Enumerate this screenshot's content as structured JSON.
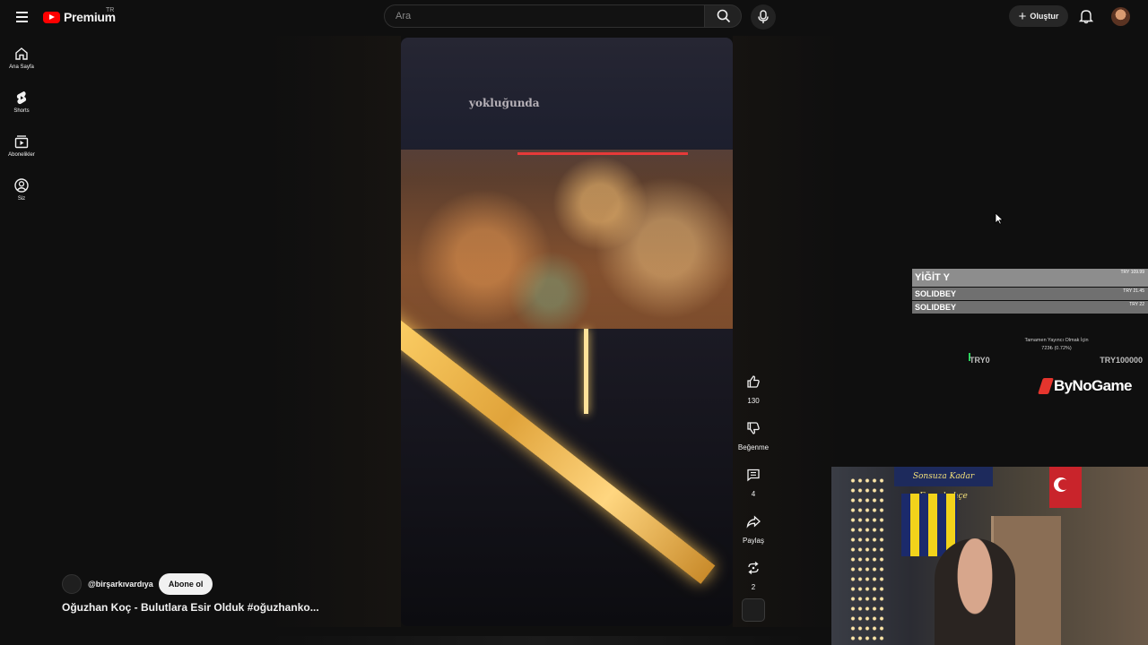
{
  "header": {
    "logo_text": "Premium",
    "country_code": "TR",
    "search_placeholder": "Ara",
    "create_label": "Oluştur"
  },
  "sidebar": {
    "items": [
      {
        "label": "Ana Sayfa",
        "icon": "home-icon"
      },
      {
        "label": "Shorts",
        "icon": "shorts-icon"
      },
      {
        "label": "Abonelikler",
        "icon": "subscriptions-icon"
      },
      {
        "label": "Siz",
        "icon": "account-circle-icon"
      }
    ]
  },
  "short": {
    "caption_overlay": "yokluğunda",
    "channel_name": "@birşarkıvardıya",
    "subscribe_label": "Abone ol",
    "title": "Oğuzhan Koç - Bulutlara Esir Olduk #oğuzhanko..."
  },
  "actions": {
    "like_count": "130",
    "dislike_label": "Beğenme",
    "comment_count": "4",
    "share_label": "Paylaş",
    "remix_count": "2"
  },
  "overlay": {
    "donations": [
      {
        "name": "YİĞİT Y",
        "amount": "TRY 109.99"
      },
      {
        "name": "SOLIDBEY",
        "amount": "TRY 21.45"
      },
      {
        "name": "SOLIDBEY",
        "amount": "TRY 22"
      }
    ],
    "goal": {
      "title": "Tamamen Yayıncı Olmak İçin",
      "progress_text": "723₺ (0.72%)",
      "progress_fraction": 0.0072,
      "min_label": "TRY0",
      "max_label": "TRY100000"
    },
    "brand": "ByNoGame",
    "webcam_banner": "Sonsuza Kadar Fenerbahçe"
  },
  "colors": {
    "background": "#0f0f0f",
    "youtube_red": "#ff0000",
    "subscribe_bg": "#f1f1f1",
    "goal_bar": "#27d35a"
  }
}
